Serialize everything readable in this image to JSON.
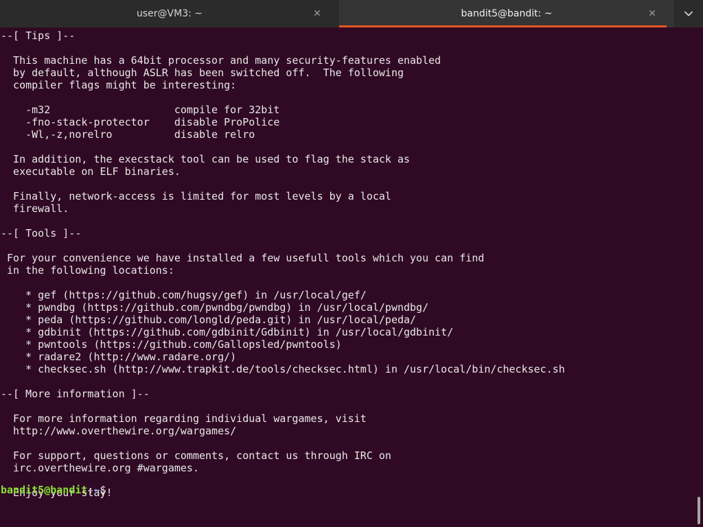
{
  "tabs": [
    {
      "title": "user@VM3: ~",
      "close_glyph": "✕",
      "active": false
    },
    {
      "title": "bandit5@bandit: ~",
      "close_glyph": "✕",
      "active": true
    }
  ],
  "tab_menu": {
    "icon": "chevron-down-icon"
  },
  "colors": {
    "terminal_background": "#300a24",
    "active_tab_underline": "#e95420",
    "prompt_user": "#8ae234",
    "prompt_path": "#729fcf"
  },
  "terminal": {
    "lines": [
      "--[ Tips ]--",
      "",
      "  This machine has a 64bit processor and many security-features enabled",
      "  by default, although ASLR has been switched off.  The following",
      "  compiler flags might be interesting:",
      "",
      "    -m32                    compile for 32bit",
      "    -fno-stack-protector    disable ProPolice",
      "    -Wl,-z,norelro          disable relro",
      "",
      "  In addition, the execstack tool can be used to flag the stack as",
      "  executable on ELF binaries.",
      "",
      "  Finally, network-access is limited for most levels by a local",
      "  firewall.",
      "",
      "--[ Tools ]--",
      "",
      " For your convenience we have installed a few usefull tools which you can find",
      " in the following locations:",
      "",
      "    * gef (https://github.com/hugsy/gef) in /usr/local/gef/",
      "    * pwndbg (https://github.com/pwndbg/pwndbg) in /usr/local/pwndbg/",
      "    * peda (https://github.com/longld/peda.git) in /usr/local/peda/",
      "    * gdbinit (https://github.com/gdbinit/Gdbinit) in /usr/local/gdbinit/",
      "    * pwntools (https://github.com/Gallopsled/pwntools)",
      "    * radare2 (http://www.radare.org/)",
      "    * checksec.sh (http://www.trapkit.de/tools/checksec.html) in /usr/local/bin/checksec.sh",
      "",
      "--[ More information ]--",
      "",
      "  For more information regarding individual wargames, visit",
      "  http://www.overthewire.org/wargames/",
      "",
      "  For support, questions or comments, contact us through IRC on",
      "  irc.overthewire.org #wargames.",
      "",
      "  Enjoy your stay!"
    ],
    "prompt": {
      "user_host": "bandit5@bandit",
      "separator": ":",
      "path": "~",
      "symbol": "$ "
    }
  }
}
